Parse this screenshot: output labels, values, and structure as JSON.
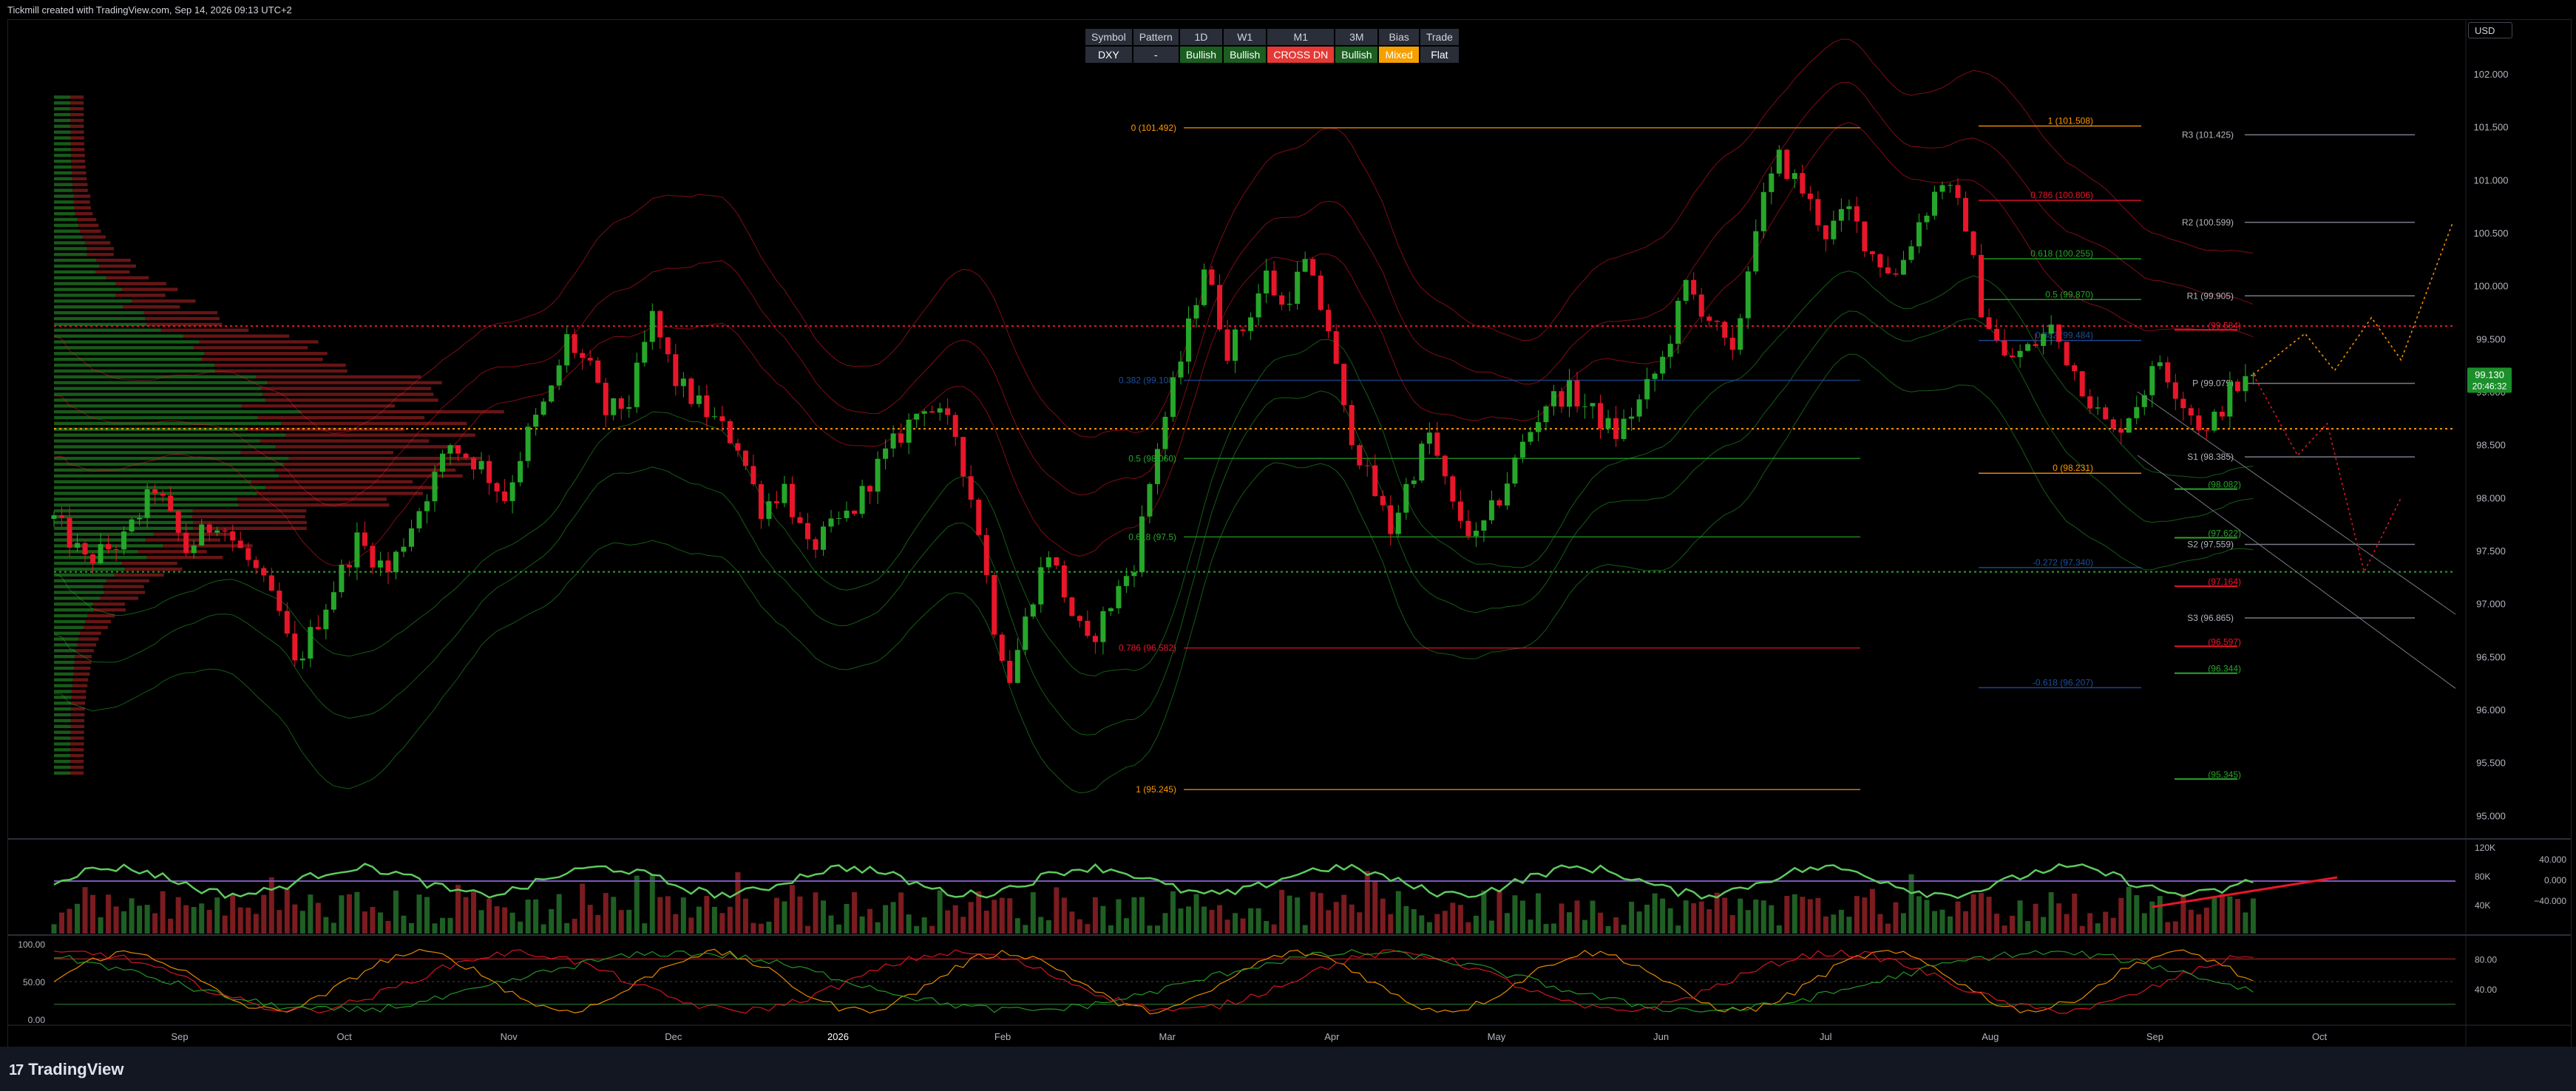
{
  "header": {
    "credit": "Tickmill created with TradingView.com, Sep 14, 2026 09:13 UTC+2",
    "currency": "USD"
  },
  "footer": {
    "brand": "TradingView",
    "brand_icon": "tradingview-logo-icon"
  },
  "signal_table": {
    "headers": [
      "Symbol",
      "Pattern",
      "1D",
      "W1",
      "M1",
      "3M",
      "Bias",
      "Trade"
    ],
    "values": [
      "DXY",
      "-",
      "Bullish",
      "Bullish",
      "CROSS DN",
      "Bullish",
      "Mixed",
      "Flat"
    ],
    "colors": [
      "#2a2e39",
      "#2a2e39",
      "#1b5e20",
      "#1b5e20",
      "#e53935",
      "#1b5e20",
      "#f59f00",
      "#2a2e39"
    ]
  },
  "colors": {
    "bull": "#26a62a",
    "bear": "#e8162a",
    "accent_orange": "#ff9800",
    "fib_blue": "#1e4e9a",
    "price_label": "#1b8f2a"
  },
  "chart_data": [
    {
      "type": "line",
      "subtype": "candlestick",
      "title": "",
      "symbol": "DXY",
      "x_months": [
        "Sep",
        "Oct",
        "Nov",
        "Dec",
        "2026",
        "Feb",
        "Mar",
        "Apr",
        "May",
        "Jun",
        "Jul",
        "Aug",
        "Sep",
        "Oct"
      ],
      "ylim": [
        94.8,
        102.3
      ],
      "y_ticks": [
        "102.000",
        "101.500",
        "101.000",
        "100.500",
        "100.000",
        "99.500",
        "99.000",
        "98.500",
        "98.000",
        "97.500",
        "97.000",
        "96.500",
        "96.000",
        "95.500",
        "95.000"
      ],
      "last_price": "99.130",
      "countdown": "20:46:32",
      "close_path": [
        [
          0,
          97.8
        ],
        [
          4,
          97.4
        ],
        [
          9,
          97.6
        ],
        [
          13,
          98.1
        ],
        [
          17,
          97.5
        ],
        [
          21,
          97.8
        ],
        [
          26,
          97.3
        ],
        [
          29,
          96.9
        ],
        [
          31,
          96.4
        ],
        [
          35,
          97.0
        ],
        [
          39,
          97.6
        ],
        [
          43,
          97.3
        ],
        [
          47,
          97.9
        ],
        [
          51,
          98.5
        ],
        [
          55,
          98.3
        ],
        [
          58,
          98.0
        ],
        [
          61,
          98.6
        ],
        [
          64,
          99.0
        ],
        [
          66,
          99.5
        ],
        [
          69,
          99.2
        ],
        [
          71,
          98.8
        ],
        [
          74,
          98.9
        ],
        [
          77,
          99.7
        ],
        [
          80,
          99.1
        ],
        [
          84,
          98.8
        ],
        [
          88,
          98.5
        ],
        [
          91,
          97.9
        ],
        [
          94,
          98.1
        ],
        [
          97,
          97.5
        ],
        [
          100,
          97.7
        ],
        [
          103,
          97.9
        ],
        [
          106,
          98.3
        ],
        [
          109,
          98.6
        ],
        [
          112,
          98.9
        ],
        [
          116,
          98.6
        ],
        [
          119,
          97.7
        ],
        [
          121,
          96.8
        ],
        [
          123,
          96.3
        ],
        [
          126,
          97.1
        ],
        [
          128,
          97.5
        ],
        [
          131,
          96.9
        ],
        [
          133,
          96.6
        ],
        [
          136,
          97.0
        ],
        [
          139,
          97.4
        ],
        [
          142,
          98.5
        ],
        [
          145,
          99.3
        ],
        [
          148,
          100.2
        ],
        [
          151,
          99.4
        ],
        [
          153,
          99.6
        ],
        [
          156,
          100.1
        ],
        [
          158,
          99.8
        ],
        [
          161,
          100.2
        ],
        [
          164,
          99.6
        ],
        [
          166,
          98.8
        ],
        [
          169,
          98.2
        ],
        [
          172,
          97.7
        ],
        [
          174,
          98.1
        ],
        [
          177,
          98.6
        ],
        [
          180,
          97.9
        ],
        [
          183,
          97.6
        ],
        [
          186,
          98.0
        ],
        [
          189,
          98.5
        ],
        [
          192,
          98.9
        ],
        [
          195,
          99.0
        ],
        [
          198,
          98.8
        ],
        [
          201,
          98.6
        ],
        [
          204,
          98.9
        ],
        [
          207,
          99.3
        ],
        [
          210,
          100.0
        ],
        [
          213,
          99.7
        ],
        [
          216,
          99.3
        ],
        [
          219,
          100.6
        ],
        [
          222,
          101.2
        ],
        [
          225,
          100.9
        ],
        [
          228,
          100.5
        ],
        [
          231,
          100.7
        ],
        [
          234,
          100.3
        ],
        [
          237,
          100.1
        ],
        [
          240,
          100.6
        ],
        [
          243,
          101.0
        ],
        [
          246,
          100.6
        ],
        [
          248,
          99.8
        ],
        [
          251,
          99.3
        ],
        [
          254,
          99.4
        ],
        [
          257,
          99.6
        ],
        [
          260,
          99.2
        ],
        [
          263,
          98.8
        ],
        [
          265,
          98.6
        ],
        [
          268,
          98.9
        ],
        [
          271,
          99.3
        ],
        [
          274,
          98.9
        ],
        [
          277,
          98.6
        ],
        [
          280,
          99.0
        ],
        [
          283,
          99.13
        ]
      ],
      "volume_profile": "left-aligned horizontal histogram, green and red",
      "horizontal_levels": [
        {
          "price": 99.62,
          "color": "#e8162a",
          "style": "dotted"
        },
        {
          "price": 98.65,
          "color": "#ff9800",
          "style": "dotted"
        },
        {
          "price": 97.3,
          "color": "#26a62a",
          "style": "dotted"
        }
      ],
      "fib_left_labels": [
        {
          "text": "0 (101.492)",
          "price": 101.492,
          "color": "#ff9800"
        },
        {
          "text": "0.382 (99.108)",
          "price": 99.108,
          "color": "#1e4e9a"
        },
        {
          "text": "0.5 (98.060)",
          "price": 98.37,
          "color": "#26a62a"
        },
        {
          "text": "0.618 (97.5)",
          "price": 97.63,
          "color": "#26a62a"
        },
        {
          "text": "0.786 (96.582)",
          "price": 96.582,
          "color": "#e8162a"
        },
        {
          "text": "1 (95.245)",
          "price": 95.245,
          "color": "#ff9800"
        }
      ],
      "fib_right_labels": [
        {
          "text": "1 (101.508)",
          "price": 101.508,
          "color": "#ff9800"
        },
        {
          "text": "0.786 (100.806)",
          "price": 100.806,
          "color": "#e8162a"
        },
        {
          "text": "0.618 (100.255)",
          "price": 100.255,
          "color": "#26a62a"
        },
        {
          "text": "0.5 (99.870)",
          "price": 99.87,
          "color": "#26a62a"
        },
        {
          "text": "0.382 (99.484)",
          "price": 99.484,
          "color": "#1e4e9a"
        },
        {
          "text": "0 (98.231)",
          "price": 98.231,
          "color": "#ff9800"
        },
        {
          "text": "-0.272 (97.340)",
          "price": 97.34,
          "color": "#1e4e9a"
        },
        {
          "text": "-0.618 (96.207)",
          "price": 96.207,
          "color": "#1e4e9a"
        }
      ],
      "pivot_labels": [
        {
          "text": "R3 (101.425)",
          "price": 101.425
        },
        {
          "text": "R2 (100.599)",
          "price": 100.599
        },
        {
          "text": "R1 (99.905)",
          "price": 99.905
        },
        {
          "text": "P (99.079)",
          "price": 99.079
        },
        {
          "text": "S1 (98.385)",
          "price": 98.385
        },
        {
          "text": "S2 (97.559)",
          "price": 97.559
        },
        {
          "text": "S3 (96.865)",
          "price": 96.865
        }
      ],
      "band_labels": [
        {
          "text": "(99.584)",
          "price": 99.584,
          "color": "#e8162a"
        },
        {
          "text": "(98.082)",
          "price": 98.082,
          "color": "#26a62a"
        },
        {
          "text": "(97.622)",
          "price": 97.622,
          "color": "#26a62a"
        },
        {
          "text": "(97.164)",
          "price": 97.164,
          "color": "#e8162a"
        },
        {
          "text": "(96.597)",
          "price": 96.597,
          "color": "#e8162a"
        },
        {
          "text": "(96.344)",
          "price": 96.344,
          "color": "#26a62a"
        },
        {
          "text": "(95.345)",
          "price": 95.345,
          "color": "#26a62a"
        }
      ]
    },
    {
      "type": "bar",
      "title": "",
      "y_ticks_volume": [
        "120K",
        "80K",
        "40K"
      ],
      "y_ticks_oscillator": [
        "40.000",
        "0.000",
        "−40.000"
      ]
    },
    {
      "type": "line",
      "title": "",
      "y_ticks_left": [
        "100.00",
        "50.00",
        "0.00"
      ],
      "y_ticks_right": [
        "80.00",
        "40.00"
      ]
    }
  ]
}
